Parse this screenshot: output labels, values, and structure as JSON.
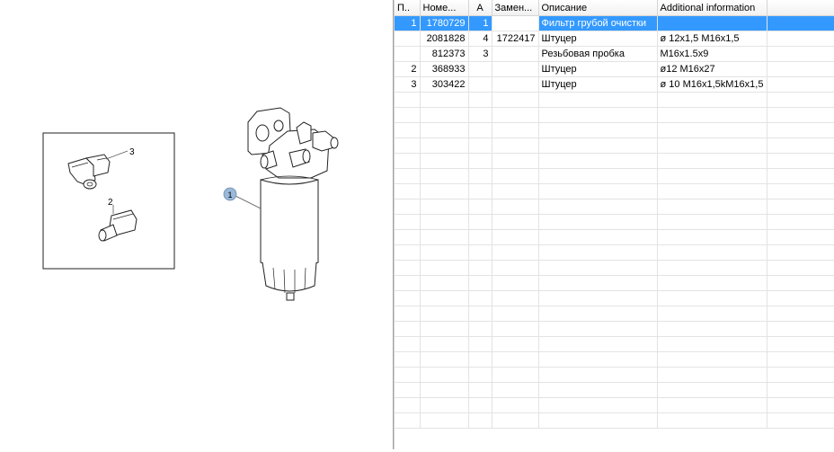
{
  "diagram": {
    "callouts": [
      {
        "label": "1"
      },
      {
        "label": "2"
      },
      {
        "label": "3"
      }
    ]
  },
  "grid": {
    "columns": [
      "П..",
      "Номе...",
      "А",
      "Замен...",
      "Описание",
      "Additional information"
    ],
    "rows": [
      {
        "pos": "1",
        "number": "1780729",
        "qty": "1",
        "replacement": "",
        "description": "Фильтр грубой очистки",
        "info": "",
        "selected": true
      },
      {
        "pos": "",
        "number": "2081828",
        "qty": "4",
        "replacement": "1722417",
        "description": "Штуцер",
        "info": "ø 12x1,5 M16x1,5",
        "selected": false
      },
      {
        "pos": "",
        "number": "812373",
        "qty": "3",
        "replacement": "",
        "description": "Резьбовая пробка",
        "info": "M16x1.5x9",
        "selected": false
      },
      {
        "pos": "2",
        "number": "368933",
        "qty": "",
        "replacement": "",
        "description": "Штуцер",
        "info": "ø12 M16x27",
        "selected": false
      },
      {
        "pos": "3",
        "number": "303422",
        "qty": "",
        "replacement": "",
        "description": "Штуцер",
        "info": "ø 10 M16x1,5kM16x1,5",
        "selected": false
      }
    ],
    "empty_rows": 22
  },
  "colors": {
    "selection": "#3399ff",
    "callout_bubble": "#9ab8d8"
  }
}
